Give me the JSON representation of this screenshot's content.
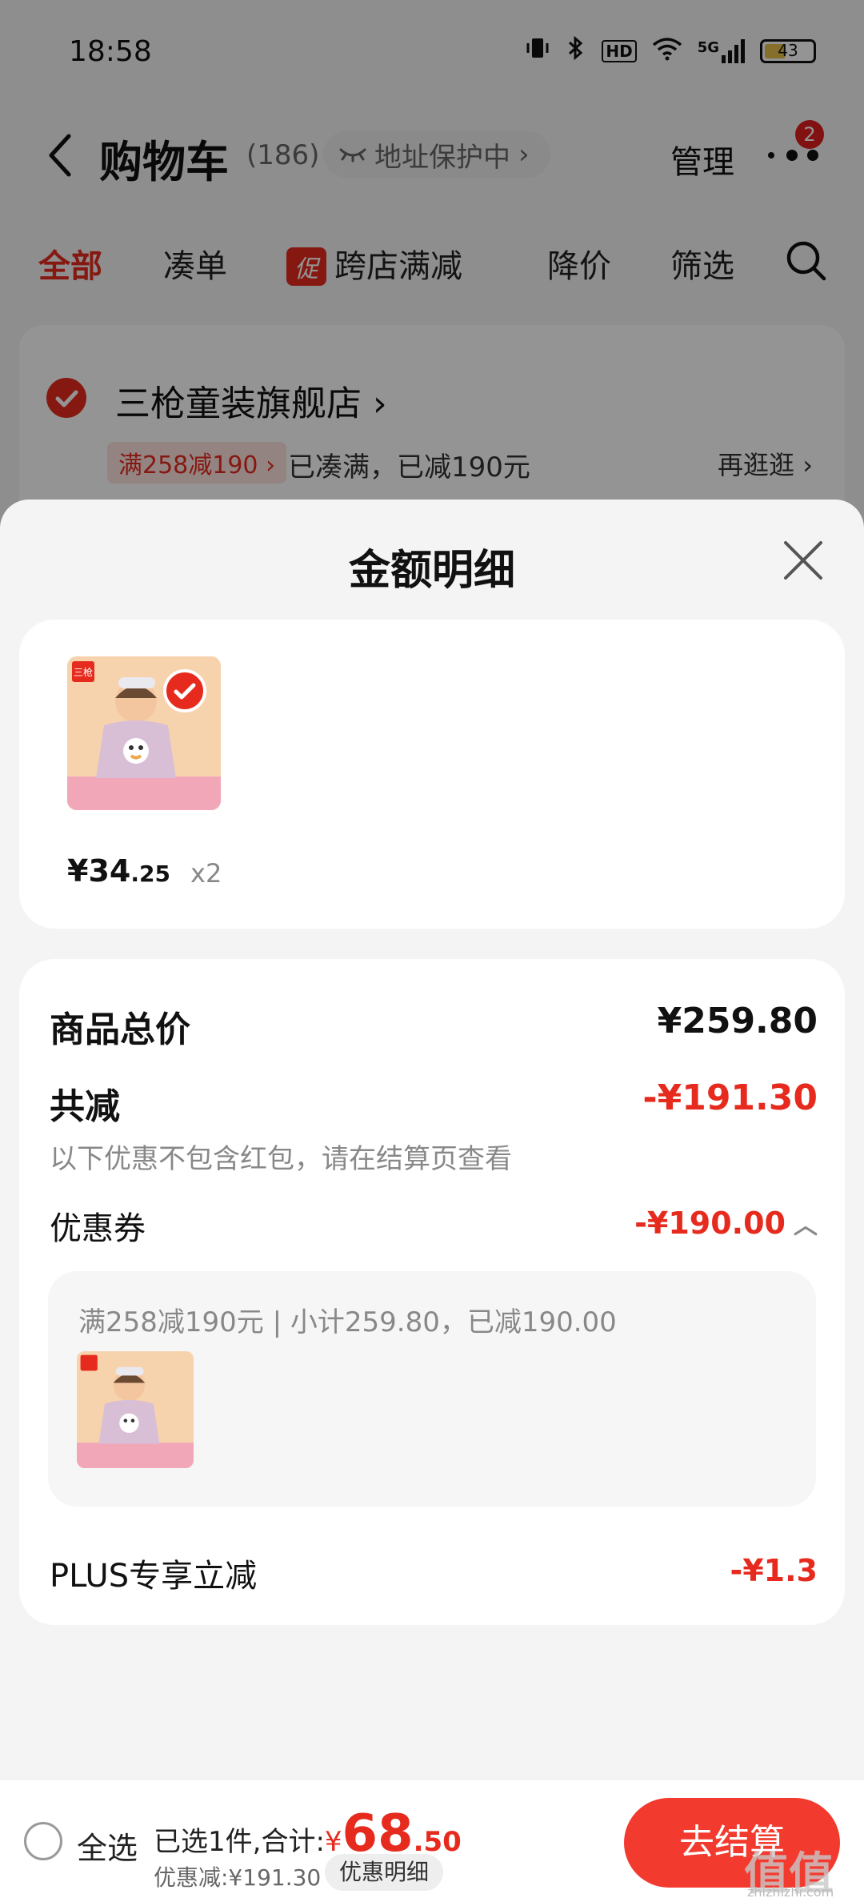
{
  "status_bar": {
    "time": "18:58",
    "signal": "5G",
    "hd": "HD",
    "battery_level": "43"
  },
  "header": {
    "title": "购物车",
    "count": "(186)",
    "address_protect": "地址保护中",
    "manage": "管理",
    "more_badge": "2"
  },
  "tabs": [
    {
      "label": "全部",
      "active": true
    },
    {
      "label": "凑单"
    },
    {
      "label": "跨店满减",
      "tag": "促"
    },
    {
      "label": "降价"
    },
    {
      "label": "筛选"
    }
  ],
  "store": {
    "name": "三枪童装旗舰店",
    "coupon_tag": "满258减190",
    "status": "已凑满，已减190元",
    "more": "再逛逛"
  },
  "sheet": {
    "title": "金额明细",
    "product": {
      "brand_mark": "三枪",
      "price_int": "¥34",
      "price_dec": ".25",
      "qty": "x2"
    },
    "summary": {
      "total_label": "商品总价",
      "total_value": "¥259.80",
      "reduce_label": "共减",
      "reduce_value": "-¥191.30",
      "reduce_note": "以下优惠不包含红包，请在结算页查看",
      "coupon_label": "优惠券",
      "coupon_value": "-¥190.00",
      "coupon_desc": "满258减190元 | 小计259.80，已减190.00",
      "plus_label": "PLUS专享立减",
      "plus_value": "-¥1.3"
    }
  },
  "bottom_bar": {
    "select_all": "全选",
    "selected_text": "已选1件,合计:",
    "total_yen": "¥",
    "total_int": "68",
    "total_dec": ".50",
    "discount": "优惠减:¥191.30",
    "detail_button": "优惠明细",
    "checkout": "去结算"
  },
  "watermark": {
    "logo": "值值值",
    "site": "zhizhizhi.com"
  },
  "colors": {
    "accent": "#e62b1e",
    "checkout": "#f23a2e",
    "sheet_bg": "#f4f4f4"
  }
}
